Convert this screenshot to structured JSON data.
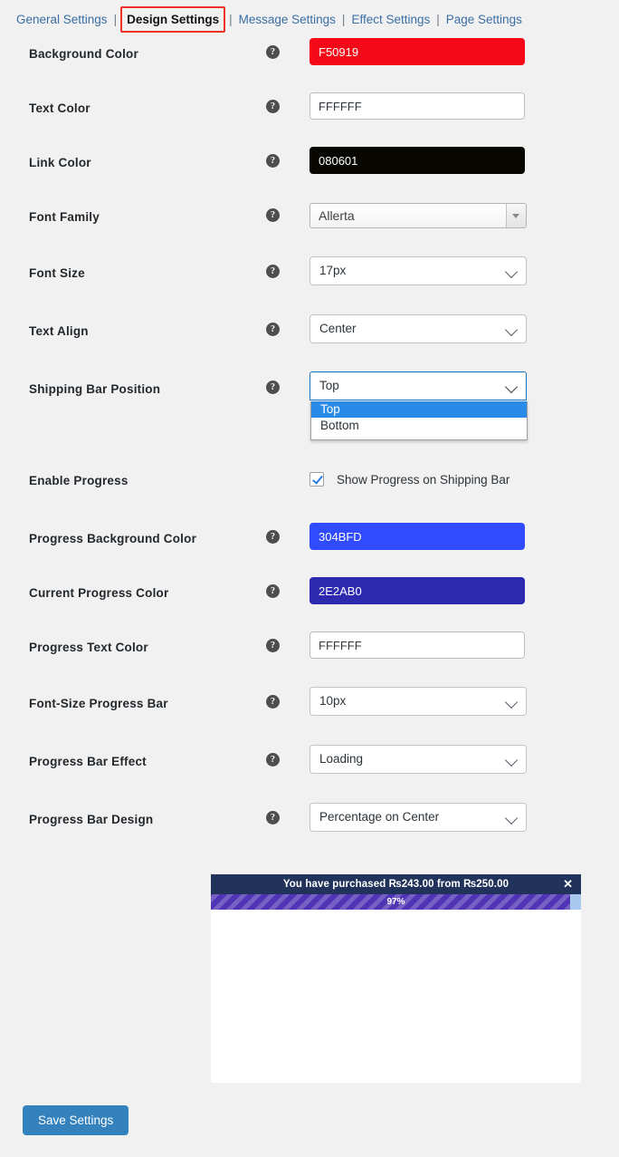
{
  "tabs": [
    {
      "label": "General Settings",
      "active": false
    },
    {
      "label": "Design Settings",
      "active": true
    },
    {
      "label": "Message Settings",
      "active": false
    },
    {
      "label": "Effect Settings",
      "active": false
    },
    {
      "label": "Page Settings",
      "active": false
    }
  ],
  "tab_separator": "|",
  "help_icon_glyph": "?",
  "rows": {
    "background_color": {
      "label": "Background Color",
      "value": "F50919"
    },
    "text_color": {
      "label": "Text Color",
      "value": "FFFFFF"
    },
    "link_color": {
      "label": "Link Color",
      "value": "080601"
    },
    "font_family": {
      "label": "Font Family",
      "value": "Allerta"
    },
    "font_size": {
      "label": "Font Size",
      "value": "17px"
    },
    "text_align": {
      "label": "Text Align",
      "value": "Center"
    },
    "shipping_bar_position": {
      "label": "Shipping Bar Position",
      "value": "Top",
      "options": [
        "Top",
        "Bottom"
      ],
      "selected_option": "Top",
      "expanded": true
    },
    "enable_progress": {
      "label": "Enable Progress",
      "checkbox_label": "Show Progress on Shipping Bar",
      "checked": true
    },
    "progress_background_color": {
      "label": "Progress Background Color",
      "value": "304BFD"
    },
    "current_progress_color": {
      "label": "Current Progress Color",
      "value": "2E2AB0"
    },
    "progress_text_color": {
      "label": "Progress Text Color",
      "value": "FFFFFF"
    },
    "font_size_progress_bar": {
      "label": "Font-Size Progress Bar",
      "value": "10px"
    },
    "progress_bar_effect": {
      "label": "Progress Bar Effect",
      "value": "Loading"
    },
    "progress_bar_design": {
      "label": "Progress Bar Design",
      "value": "Percentage on Center"
    }
  },
  "preview": {
    "message": "You have purchased ₨243.00 from ₨250.00",
    "progress_percent_label": "97%",
    "progress_percent": 97,
    "close_glyph": "✕",
    "bar_background_color": "#21325B",
    "progress_fill_color": "#4F34B5",
    "progress_track_color": "#A8C8F0"
  },
  "footer": {
    "save_label": "Save Settings"
  }
}
